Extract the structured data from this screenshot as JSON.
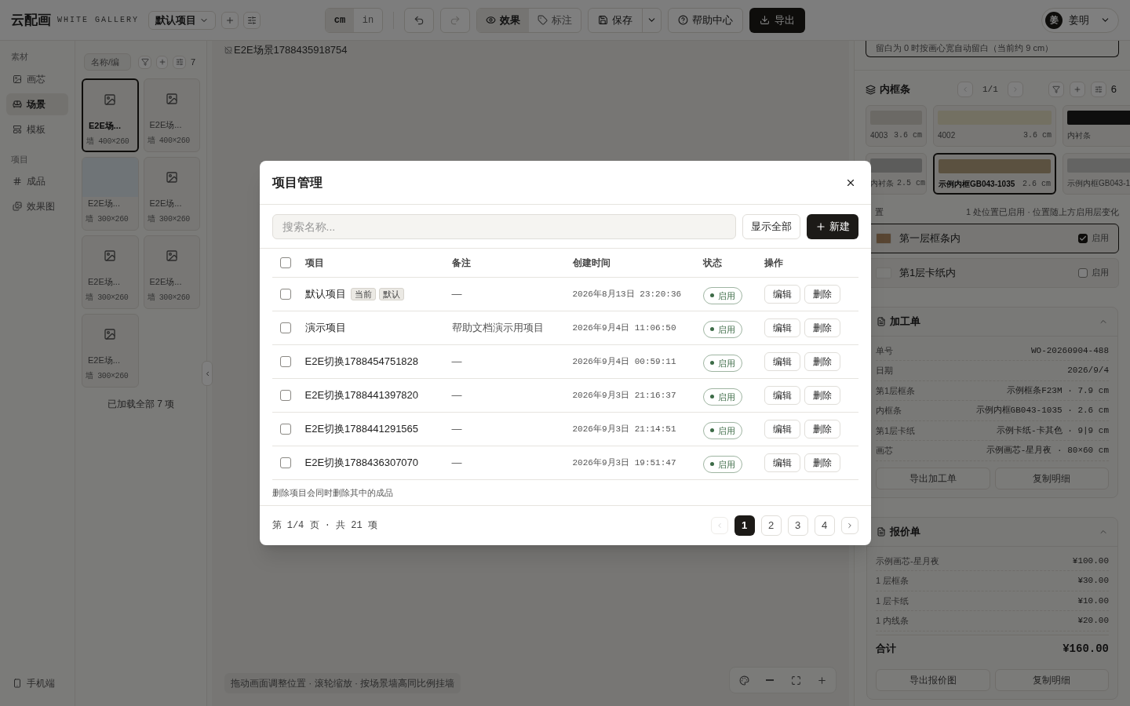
{
  "topbar": {
    "logo": "云配画",
    "subtitle": "WHITE GALLERY",
    "project_select": "默认项目",
    "units": [
      {
        "label": "cm",
        "selected": true
      },
      {
        "label": "in",
        "selected": false
      }
    ],
    "undo_disabled": false,
    "redo_disabled": true,
    "views": [
      {
        "label": "效果",
        "selected": true
      },
      {
        "label": "标注",
        "selected": false
      }
    ],
    "save": "保存",
    "help": "帮助中心",
    "export": "导出",
    "user": {
      "initial": "姜",
      "name": "姜明"
    }
  },
  "nav": {
    "sections": [
      {
        "title": "素材",
        "items": [
          {
            "label": "画芯",
            "selected": false
          },
          {
            "label": "场景",
            "selected": true
          },
          {
            "label": "模板",
            "selected": false
          }
        ]
      },
      {
        "title": "项目",
        "items": [
          {
            "label": "成品",
            "selected": false
          },
          {
            "label": "效果图",
            "selected": false
          }
        ]
      }
    ],
    "footer": "手机端"
  },
  "library": {
    "search_placeholder": "名称/编",
    "count": "7",
    "items": [
      {
        "name": "E2E场...",
        "size": "墙 400×260",
        "selected": true,
        "kind": "icon"
      },
      {
        "name": "E2E场...",
        "size": "墙 400×260",
        "selected": false,
        "kind": "icon"
      },
      {
        "name": "E2E场...",
        "size": "墙 300×260",
        "selected": false,
        "kind": "photo"
      },
      {
        "name": "E2E场...",
        "size": "墙 300×260",
        "selected": false,
        "kind": "icon"
      },
      {
        "name": "E2E场...",
        "size": "墙 300×260",
        "selected": false,
        "kind": "icon"
      },
      {
        "name": "E2E场...",
        "size": "墙 300×260",
        "selected": false,
        "kind": "icon"
      },
      {
        "name": "E2E场...",
        "size": "墙 300×260",
        "selected": false,
        "kind": "icon"
      }
    ],
    "footer": "已加载全部 7 项"
  },
  "canvas": {
    "image_alt": "E2E场景1788435918754",
    "hint": "拖动画面调整位置 · 滚轮缩放 · 按场景墙高同比例挂墙"
  },
  "right": {
    "margin_note": "留白为 0 时按画心宽自动留白（当前约 9 cm）",
    "inner_frame": {
      "title": "内框条",
      "page": "1/1",
      "count": "6",
      "items": [
        {
          "name": "4003",
          "width": "3.6 cm",
          "selected": false
        },
        {
          "name": "4002",
          "width": "3.6 cm",
          "selected": false
        },
        {
          "name": "内衬条",
          "selected": false
        },
        {
          "name": "内衬条",
          "width": "2.5 cm",
          "selected": false
        },
        {
          "name": "示例内框GB043-1035",
          "width": "2.6 cm",
          "selected": true
        },
        {
          "name": "示例内框GB043-1",
          "selected": false
        }
      ]
    },
    "positions": {
      "title": "置",
      "summary": "1 处位置已启用 · 位置随上方启用层变化",
      "items": [
        {
          "label": "第一层框条内",
          "enabled": true,
          "toggle": "启用"
        },
        {
          "label": "第1层卡纸内",
          "enabled": false,
          "toggle": "启用"
        }
      ]
    },
    "work_order": {
      "title": "加工单",
      "expanded": true,
      "rows": [
        {
          "label": "单号",
          "value": "WO-20260904-488"
        },
        {
          "label": "日期",
          "value": "2026/9/4"
        },
        {
          "label": "第1层框条",
          "value": "示例框条F23M · 7.9 cm"
        },
        {
          "label": "内框条",
          "value": "示例内框GB043-1035 · 2.6 cm"
        },
        {
          "label": "第1层卡纸",
          "value": "示例卡纸-卡其色 · 9|9 cm"
        },
        {
          "label": "画芯",
          "value": "示例画芯-星月夜 · 80×60 cm"
        }
      ],
      "buttons": [
        "导出加工单",
        "复制明细"
      ]
    },
    "quote": {
      "title": "报价单",
      "expanded": true,
      "rows": [
        {
          "label": "示例画芯-星月夜",
          "value": "¥100.00"
        },
        {
          "label": "1 层框条",
          "value": "¥30.00"
        },
        {
          "label": "1 层卡纸",
          "value": "¥10.00"
        },
        {
          "label": "1 内线条",
          "value": "¥20.00"
        }
      ],
      "total_label": "合计",
      "total_value": "¥160.00",
      "buttons": [
        "导出报价图",
        "复制明细"
      ]
    }
  },
  "modal": {
    "title": "项目管理",
    "search_placeholder": "搜索名称...",
    "show_all": "显示全部",
    "new": "新建",
    "all_checked": false,
    "columns": [
      "项目",
      "备注",
      "创建时间",
      "状态",
      "操作"
    ],
    "rows": [
      {
        "name": "默认项目",
        "tags": [
          "当前",
          "默认"
        ],
        "note": "—",
        "created": "2026年8月13日 23:20:36",
        "status": "启用",
        "enabled": true,
        "checked": false,
        "actions": [
          "编辑",
          "删除"
        ]
      },
      {
        "name": "演示项目",
        "note": "帮助文档演示用项目",
        "created": "2026年9月4日 11:06:50",
        "status": "启用",
        "enabled": true,
        "checked": false,
        "actions": [
          "编辑",
          "删除"
        ]
      },
      {
        "name": "E2E切换1788454751828",
        "note": "—",
        "created": "2026年9月4日 00:59:11",
        "status": "启用",
        "enabled": true,
        "checked": false,
        "actions": [
          "编辑",
          "删除"
        ]
      },
      {
        "name": "E2E切换1788441397820",
        "note": "—",
        "created": "2026年9月3日 21:16:37",
        "status": "启用",
        "enabled": true,
        "checked": false,
        "actions": [
          "编辑",
          "删除"
        ]
      },
      {
        "name": "E2E切换1788441291565",
        "note": "—",
        "created": "2026年9月3日 21:14:51",
        "status": "启用",
        "enabled": true,
        "checked": false,
        "actions": [
          "编辑",
          "删除"
        ]
      },
      {
        "name": "E2E切换1788436307070",
        "note": "—",
        "created": "2026年9月3日 19:51:47",
        "status": "启用",
        "enabled": true,
        "checked": false,
        "actions": [
          "编辑",
          "删除"
        ]
      }
    ],
    "footnote": "删除项目会同时删除其中的成品",
    "page_info": "第 1/4 页 · 共 21 项",
    "pages": [
      {
        "label": "1",
        "selected": true
      },
      {
        "label": "2",
        "selected": false
      },
      {
        "label": "3",
        "selected": false
      },
      {
        "label": "4",
        "selected": false
      }
    ],
    "prev_disabled": true,
    "next_disabled": false
  }
}
